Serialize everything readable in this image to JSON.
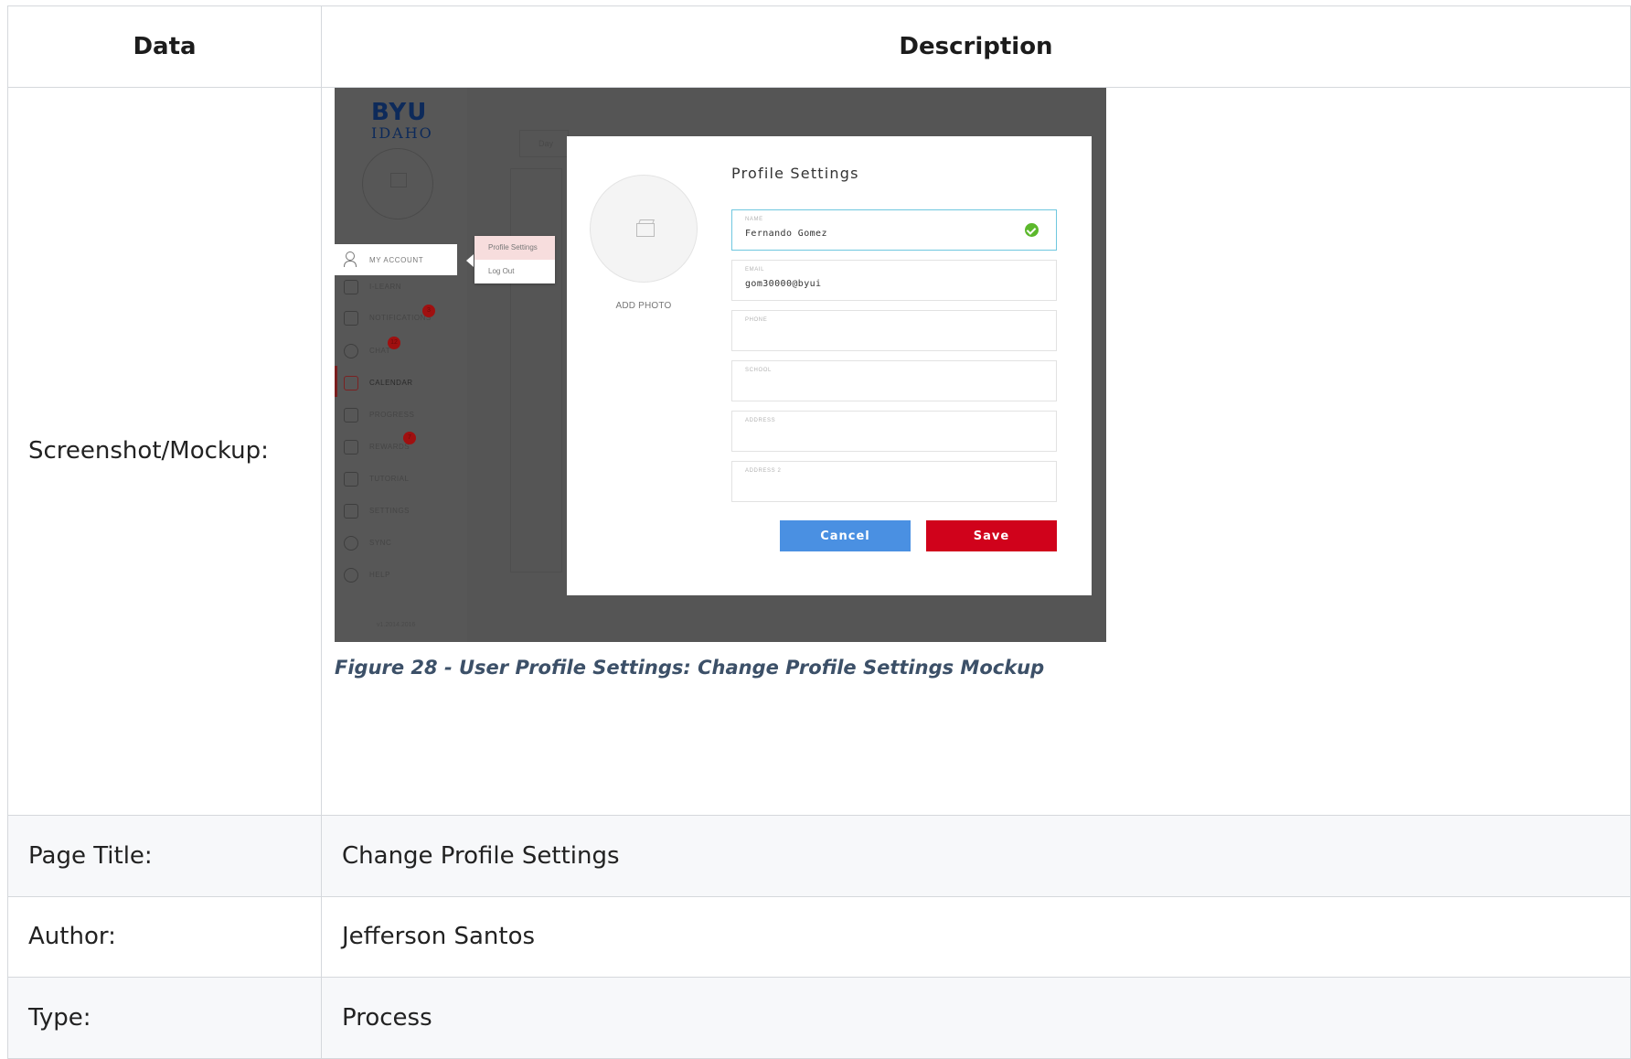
{
  "table": {
    "header": {
      "data": "Data",
      "description": "Description"
    },
    "rows": [
      {
        "label": "Screenshot/Mockup:"
      },
      {
        "label": "Page Title:",
        "value": "Change Profile Settings"
      },
      {
        "label": "Author:",
        "value": "Jefferson Santos"
      },
      {
        "label": "Type:",
        "value": "Process"
      }
    ]
  },
  "caption": "Figure 28 - User Profile Settings: Change Profile Settings Mockup",
  "mockup": {
    "logo": {
      "line1": "BYU",
      "line2": "IDAHO"
    },
    "background": {
      "view_button": "Day"
    },
    "sidebar": {
      "account": "MY ACCOUNT",
      "items": [
        {
          "label": "I-LEARN",
          "icon": "home-icon"
        },
        {
          "label": "NOTIFICATIONS",
          "icon": "mail-icon",
          "badge": "3"
        },
        {
          "label": "CHAT",
          "icon": "chat-icon",
          "badge": "12"
        },
        {
          "label": "CALENDAR",
          "icon": "calendar-icon",
          "active": true
        },
        {
          "label": "PROGRESS",
          "icon": "chart-icon"
        },
        {
          "label": "REWARDS",
          "icon": "trophy-icon",
          "badge": "7"
        },
        {
          "label": "TUTORIAL",
          "icon": "play-icon"
        },
        {
          "label": "SETTINGS",
          "icon": "sliders-icon"
        },
        {
          "label": "SYNC",
          "icon": "sync-icon"
        },
        {
          "label": "HELP",
          "icon": "help-icon"
        }
      ],
      "version": "v1.2014.2016"
    },
    "account_menu": {
      "item1": "Profile Settings",
      "item2": "Log Out"
    },
    "modal": {
      "title": "Profile Settings",
      "add_photo": "ADD PHOTO",
      "fields": [
        {
          "label": "NAME",
          "value": "Fernando Gomez",
          "focused": true,
          "valid": true
        },
        {
          "label": "EMAIL",
          "value": "gom30000@byui"
        },
        {
          "label": "PHONE",
          "value": ""
        },
        {
          "label": "SCHOOL",
          "value": ""
        },
        {
          "label": "ADDRESS",
          "value": ""
        },
        {
          "label": "ADDRESS 2",
          "value": ""
        }
      ],
      "cancel": "Cancel",
      "save": "Save"
    },
    "colors": {
      "cancel": "#4a90e2",
      "save": "#d0021b",
      "focus": "#6fc7df",
      "valid": "#5cb82c"
    }
  }
}
